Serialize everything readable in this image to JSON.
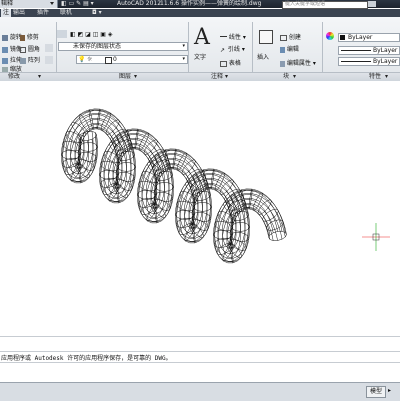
{
  "title_bar": {
    "workspace": "辑释",
    "app_name": "AutoCAD 2012",
    "file_title": "11.6.6 操作实例——弹簧的绘制.dwg",
    "search_placeholder": "键入关键字或短语"
  },
  "menu_tabs": [
    "注",
    "输出",
    "插件",
    "联机"
  ],
  "ribbon": {
    "modify": {
      "items": [
        "旋转",
        "修剪",
        "镜像",
        "圆角",
        "拉伸",
        "缩放",
        "阵列"
      ],
      "label": "修改"
    },
    "layers": {
      "state": "未保存的图层状态",
      "current_layer": "0",
      "label": "图层"
    },
    "annotation": {
      "text": "文字",
      "linear": "线性",
      "leader": "引线",
      "table": "表格",
      "label": "注释"
    },
    "block": {
      "insert": "插入",
      "create": "创建",
      "edit": "编辑",
      "edit_attr": "编辑属性",
      "label": "块"
    },
    "properties": {
      "color": "ByLayer",
      "linetype": "ByLayer",
      "lineweight": "ByLayer",
      "label": "特性"
    }
  },
  "command": {
    "message": "应用程序或 Autodesk 许可的应用程序保存，是可靠的 DWG。"
  },
  "status": {
    "model": "模型"
  },
  "colors": {
    "title_bg": "#1f2630",
    "menu_bg": "#3a4350",
    "ribbon_bg": "#eef1f4",
    "bylayer_swatch": "#111111"
  }
}
